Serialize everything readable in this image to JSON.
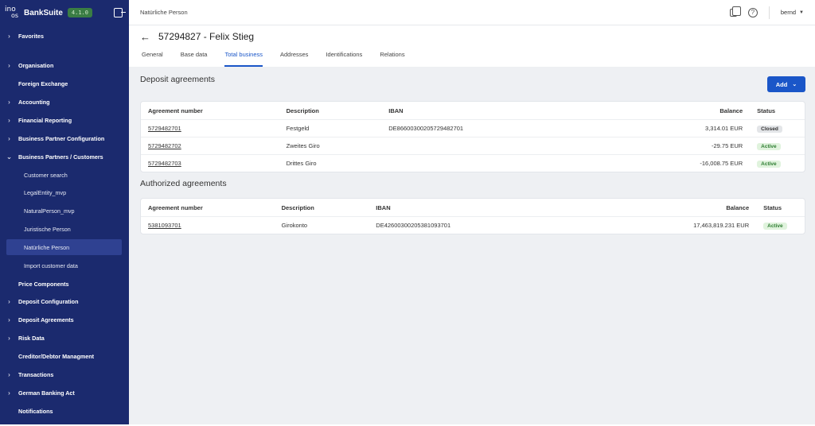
{
  "app": {
    "brand": "BankSuite",
    "version": "4.1.0",
    "logo_top": "ino",
    "logo_bottom": "os"
  },
  "sidebar": {
    "items": [
      {
        "label": "Favorites",
        "type": "group"
      },
      {
        "label": "Organisation",
        "type": "group"
      },
      {
        "label": "Foreign Exchange",
        "type": "link"
      },
      {
        "label": "Accounting",
        "type": "group"
      },
      {
        "label": "Financial Reporting",
        "type": "group"
      },
      {
        "label": "Business Partner Configuration",
        "type": "group"
      },
      {
        "label": "Business Partners / Customers",
        "type": "group-open"
      },
      {
        "label": "Customer search",
        "type": "sub"
      },
      {
        "label": "LegalEntity_mvp",
        "type": "sub"
      },
      {
        "label": "NaturalPerson_mvp",
        "type": "sub"
      },
      {
        "label": "Juristische Person",
        "type": "sub"
      },
      {
        "label": "Natürliche Person",
        "type": "sub-active"
      },
      {
        "label": "Import customer data",
        "type": "sub"
      },
      {
        "label": "Price Components",
        "type": "link"
      },
      {
        "label": "Deposit Configuration",
        "type": "group"
      },
      {
        "label": "Deposit Agreements",
        "type": "group"
      },
      {
        "label": "Risk Data",
        "type": "group"
      },
      {
        "label": "Creditor/Debtor Managment",
        "type": "link"
      },
      {
        "label": "Transactions",
        "type": "group"
      },
      {
        "label": "German Banking Act",
        "type": "group"
      },
      {
        "label": "Notifications",
        "type": "link"
      }
    ]
  },
  "topbar": {
    "breadcrumb": "Natürliche Person",
    "user": "bernd",
    "icons": [
      "copy-icon",
      "help-icon",
      "chevron-down-icon"
    ]
  },
  "page": {
    "title": "57294827 - Felix Stieg",
    "tabs": [
      {
        "label": "General",
        "active": false
      },
      {
        "label": "Base data",
        "active": false
      },
      {
        "label": "Total business",
        "active": true
      },
      {
        "label": "Addresses",
        "active": false
      },
      {
        "label": "Identifications",
        "active": false
      },
      {
        "label": "Relations",
        "active": false
      }
    ]
  },
  "deposit": {
    "title": "Deposit agreements",
    "add_label": "Add",
    "columns": [
      "Agreement number",
      "Description",
      "IBAN",
      "Balance",
      "Status"
    ],
    "rows": [
      {
        "number": "5729482701",
        "description": "Festgeld",
        "iban": "DE86600300205729482701",
        "balance": "3,314.01 EUR",
        "status": "Closed"
      },
      {
        "number": "5729482702",
        "description": "Zweites Giro",
        "iban": "",
        "balance": "-29.75 EUR",
        "status": "Active"
      },
      {
        "number": "5729482703",
        "description": "Drittes Giro",
        "iban": "",
        "balance": "-16,008.75 EUR",
        "status": "Active"
      }
    ]
  },
  "authorized": {
    "title": "Authorized agreements",
    "columns": [
      "Agreement number",
      "Description",
      "IBAN",
      "Balance",
      "Status"
    ],
    "rows": [
      {
        "number": "5381093701",
        "description": "Girokonto",
        "iban": "DE42600300205381093701",
        "balance": "17,463,819.231 EUR",
        "status": "Active"
      }
    ]
  },
  "colors": {
    "sidebar_bg": "#1b2a6e",
    "accent": "#1a56c8",
    "active_badge": "#2e7d32"
  }
}
